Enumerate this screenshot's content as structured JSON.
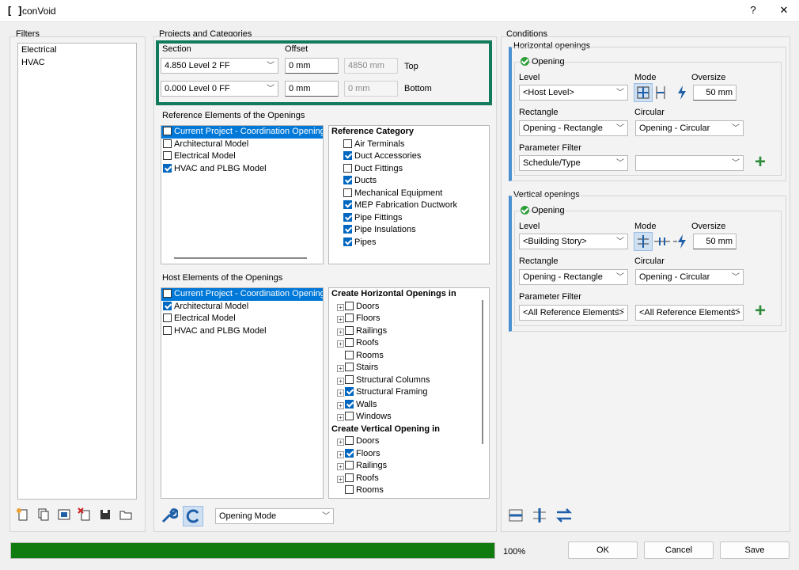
{
  "window": {
    "title": "conVoid",
    "help": "?",
    "close": "✕"
  },
  "filters": {
    "label": "Filters",
    "items": [
      "Electrical",
      "HVAC"
    ]
  },
  "projects": {
    "label": "Projects and Categories",
    "section_label": "Section",
    "offset_label": "Offset",
    "rows": [
      {
        "level": "4.850  Level 2 FF",
        "offset": "0 mm",
        "result": "4850 mm",
        "side": "Top"
      },
      {
        "level": "0.000  Level 0 FF",
        "offset": "0 mm",
        "result": "0 mm",
        "side": "Bottom"
      }
    ],
    "highlight_color": "#127a5d"
  },
  "reference": {
    "label": "Reference Elements of the Openings",
    "sources": [
      {
        "label": "Current Project - Coordination Openings",
        "checked": false,
        "selected": true
      },
      {
        "label": "Architectural Model",
        "checked": false
      },
      {
        "label": "Electrical Model",
        "checked": false
      },
      {
        "label": "HVAC and PLBG Model",
        "checked": true
      }
    ],
    "category_header": "Reference Category",
    "categories": [
      {
        "label": "Air Terminals",
        "checked": false
      },
      {
        "label": "Duct Accessories",
        "checked": true
      },
      {
        "label": "Duct Fittings",
        "checked": false
      },
      {
        "label": "Ducts",
        "checked": true
      },
      {
        "label": "Mechanical Equipment",
        "checked": false
      },
      {
        "label": "MEP Fabrication Ductwork",
        "checked": true
      },
      {
        "label": "Pipe Fittings",
        "checked": true
      },
      {
        "label": "Pipe Insulations",
        "checked": true
      },
      {
        "label": "Pipes",
        "checked": true
      }
    ]
  },
  "host": {
    "label": "Host Elements of the Openings",
    "sources": [
      {
        "label": "Current Project - Coordination Openings",
        "checked": false,
        "selected": true
      },
      {
        "label": "Architectural Model",
        "checked": true
      },
      {
        "label": "Electrical Model",
        "checked": false
      },
      {
        "label": "HVAC and PLBG Model",
        "checked": false
      }
    ],
    "horizontal_header": "Create Horizontal Openings in",
    "horizontal": [
      {
        "label": "Doors",
        "checked": false,
        "expand": true
      },
      {
        "label": "Floors",
        "checked": false,
        "expand": true
      },
      {
        "label": "Railings",
        "checked": false,
        "expand": true
      },
      {
        "label": "Roofs",
        "checked": false,
        "expand": true
      },
      {
        "label": "Rooms",
        "checked": false,
        "expand": false
      },
      {
        "label": "Stairs",
        "checked": false,
        "expand": true
      },
      {
        "label": "Structural Columns",
        "checked": false,
        "expand": true
      },
      {
        "label": "Structural Framing",
        "checked": true,
        "expand": true
      },
      {
        "label": "Walls",
        "checked": true,
        "expand": true
      },
      {
        "label": "Windows",
        "checked": false,
        "expand": true
      }
    ],
    "vertical_header": "Create Vertical Opening in",
    "vertical": [
      {
        "label": "Doors",
        "checked": false,
        "expand": true
      },
      {
        "label": "Floors",
        "checked": true,
        "expand": true
      },
      {
        "label": "Railings",
        "checked": false,
        "expand": true
      },
      {
        "label": "Roofs",
        "checked": false,
        "expand": true
      },
      {
        "label": "Rooms",
        "checked": false,
        "expand": false
      }
    ]
  },
  "mode_select": "Opening Mode",
  "conditions": {
    "label": "Conditions",
    "horizontal": {
      "label": "Horizontal openings",
      "opening_label": "Opening",
      "level_label": "Level",
      "level": "<Host Level>",
      "mode_label": "Mode",
      "oversize_label": "Oversize",
      "oversize": "50 mm",
      "rect_label": "Rectangle",
      "rect": "Opening - Rectangle",
      "circ_label": "Circular",
      "circ": "Opening - Circular",
      "param_label": "Parameter Filter",
      "param1": "Schedule/Type",
      "param2": ""
    },
    "vertical": {
      "label": "Vertical openings",
      "opening_label": "Opening",
      "level_label": "Level",
      "level": "<Building Story>",
      "mode_label": "Mode",
      "oversize_label": "Oversize",
      "oversize": "50 mm",
      "rect_label": "Rectangle",
      "rect": "Opening - Rectangle",
      "circ_label": "Circular",
      "circ": "Opening - Circular",
      "param_label": "Parameter Filter",
      "param1": "<All Reference Elements>",
      "param2": "<All Reference Elements>"
    }
  },
  "progress": {
    "value": 100,
    "text": "100%",
    "color": "#107c10"
  },
  "buttons": {
    "ok": "OK",
    "cancel": "Cancel",
    "save": "Save"
  }
}
